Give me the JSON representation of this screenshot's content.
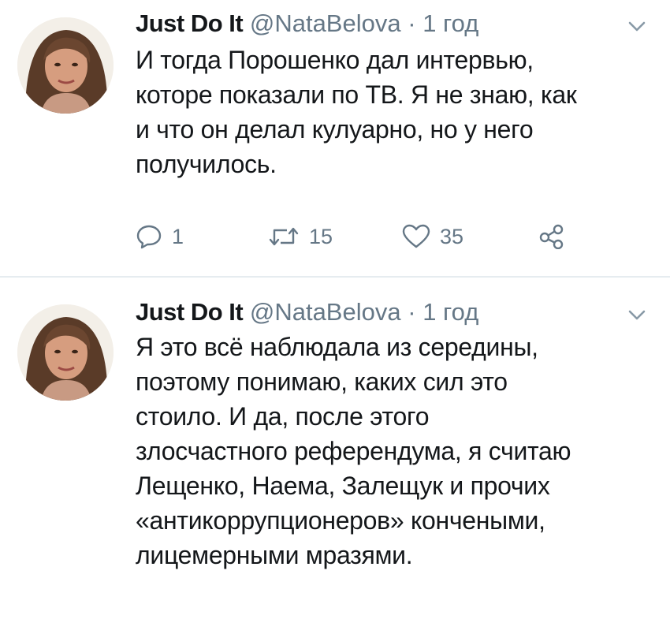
{
  "tweets": [
    {
      "display_name": "Just Do It",
      "handle": "@NataBelova",
      "separator": "·",
      "time": "1 год",
      "text": "И тогда Порошенко дал интервью,\nкоторе показали по ТВ. Я не знаю, как\nи что он делал кулуарно, но у него\nполучилось.",
      "actions": {
        "reply_count": "1",
        "retweet_count": "15",
        "like_count": "35"
      }
    },
    {
      "display_name": "Just Do It",
      "handle": "@NataBelova",
      "separator": "·",
      "time": "1 год",
      "text": "Я это всё наблюдала из середины,\nпоэтому понимаю, каких сил это\nстоило.   И да, после этого\nзлосчастного референдума, я считаю\nЛещенко, Наема, Залещук и прочих\n«антикоррупционеров» кончеными,\nлицемерными мразями."
    }
  ],
  "icons": {
    "reply": "speech-bubble-icon",
    "retweet": "retweet-arrows-icon",
    "like": "heart-outline-icon",
    "share": "share-nodes-icon",
    "menu": "chevron-down-icon"
  },
  "colors": {
    "text": "#14171a",
    "muted": "#657786",
    "divider": "#e6ecf0"
  }
}
